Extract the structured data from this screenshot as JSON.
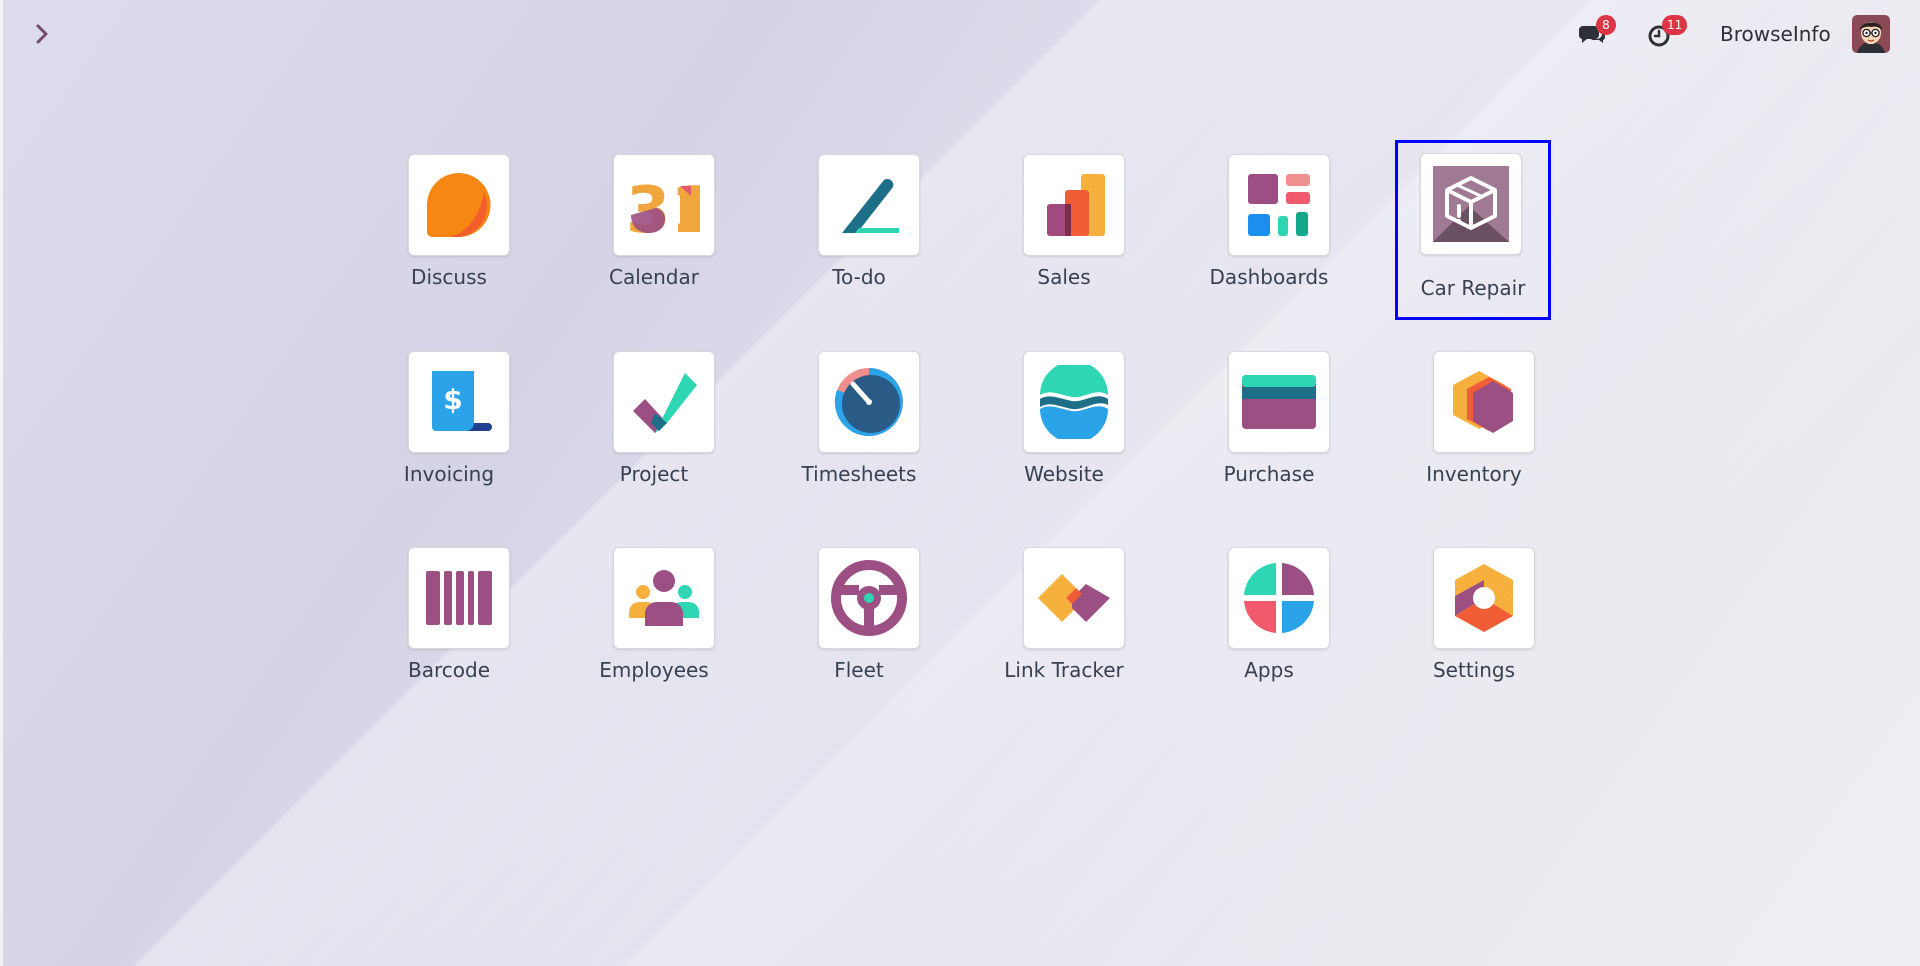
{
  "topbar": {
    "messages_badge": "8",
    "activities_badge": "11",
    "company_name": "BrowseInfo"
  },
  "apps": [
    {
      "label": "Discuss"
    },
    {
      "label": "Calendar",
      "icon_text": "31"
    },
    {
      "label": "To-do"
    },
    {
      "label": "Sales"
    },
    {
      "label": "Dashboards"
    },
    {
      "label": "Car Repair",
      "selected": true
    },
    {
      "label": "Invoicing",
      "icon_text": "$"
    },
    {
      "label": "Project"
    },
    {
      "label": "Timesheets"
    },
    {
      "label": "Website"
    },
    {
      "label": "Purchase"
    },
    {
      "label": "Inventory"
    },
    {
      "label": "Barcode"
    },
    {
      "label": "Employees"
    },
    {
      "label": "Fleet"
    },
    {
      "label": "Link Tracker"
    },
    {
      "label": "Apps"
    },
    {
      "label": "Settings"
    }
  ],
  "colors": {
    "selection_outline": "#0000ff",
    "badge": "#dc3545"
  }
}
